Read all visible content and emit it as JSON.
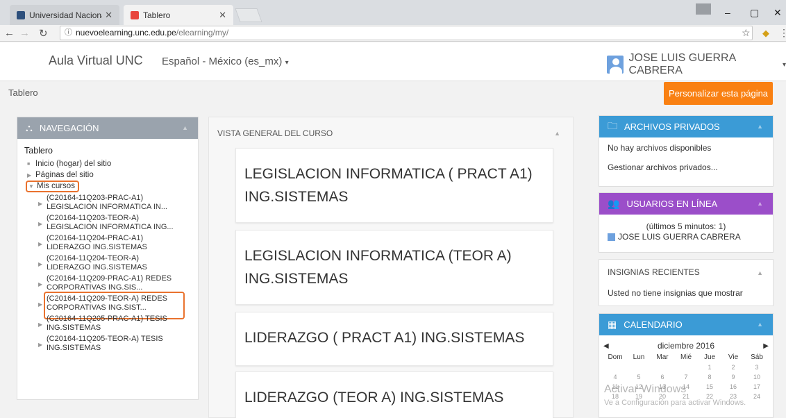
{
  "browser": {
    "tabs": [
      {
        "title": "Universidad Nacional de",
        "favicon_color": "#2d4f7c"
      },
      {
        "title": "Tablero",
        "favicon_color": "#e8453c"
      }
    ],
    "url_host": "nuevoelearning.unc.edu.pe",
    "url_path": "/elearning/my/",
    "minimize": "–",
    "maximize": "▢",
    "close": "✕"
  },
  "navbar": {
    "brand": "Aula Virtual UNC",
    "language": "Español - México (es_mx)",
    "user_name": "JOSE LUIS GUERRA CABRERA"
  },
  "breadcrumb": "Tablero",
  "customize_button": "Personalizar esta página",
  "navigation": {
    "title": "NAVEGACIÓN",
    "root": "Tablero",
    "items": [
      "Inicio (hogar) del sitio",
      "Páginas del sitio",
      "Mis cursos"
    ],
    "courses": [
      {
        "code": "(C20164-11Q203-PRAC-A1)",
        "name": "LEGISLACION INFORMATICA IN..."
      },
      {
        "code": "(C20164-11Q203-TEOR-A)",
        "name": "LEGISLACION INFORMATICA ING..."
      },
      {
        "code": "(C20164-11Q204-PRAC-A1)",
        "name": "LIDERAZGO ING.SISTEMAS"
      },
      {
        "code": "(C20164-11Q204-TEOR-A)",
        "name": "LIDERAZGO ING.SISTEMAS"
      },
      {
        "code": "(C20164-11Q209-PRAC-A1) REDES",
        "name": "CORPORATIVAS ING.SIS..."
      },
      {
        "code": "(C20164-11Q209-TEOR-A) REDES",
        "name": "CORPORATIVAS ING.SIST..."
      },
      {
        "code": "(C20164-11Q205-PRAC-A1) TESIS",
        "name": "ING.SISTEMAS"
      },
      {
        "code": "(C20164-11Q205-TEOR-A) TESIS",
        "name": "ING.SISTEMAS"
      }
    ]
  },
  "overview": {
    "title": "VISTA GENERAL DEL CURSO",
    "courses": [
      "LEGISLACION INFORMATICA ( PRACT A1) ING.SISTEMAS",
      "LEGISLACION INFORMATICA (TEOR A) ING.SISTEMAS",
      "LIDERAZGO ( PRACT A1) ING.SISTEMAS",
      "LIDERAZGO (TEOR A) ING.SISTEMAS"
    ]
  },
  "private_files": {
    "title": "ARCHIVOS PRIVADOS",
    "empty": "No hay archivos disponibles",
    "manage": "Gestionar archivos privados..."
  },
  "online_users": {
    "title": "USUARIOS EN LÍNEA",
    "summary": "(últimos 5 minutos: 1)",
    "user": "JOSE LUIS GUERRA CABRERA"
  },
  "badges": {
    "title": "INSIGNIAS RECIENTES",
    "empty": "Usted no tiene insignias que mostrar"
  },
  "calendar": {
    "title": "CALENDARIO",
    "month": "diciembre 2016",
    "weekdays": [
      "Dom",
      "Lun",
      "Mar",
      "Mié",
      "Jue",
      "Vie",
      "Sáb"
    ],
    "days": [
      "",
      "",
      "",
      "",
      "1",
      "2",
      "3",
      "4",
      "5",
      "6",
      "7",
      "8",
      "9",
      "10",
      "11",
      "12",
      "13",
      "14",
      "15",
      "16",
      "17",
      "18",
      "19",
      "20",
      "21",
      "22",
      "23",
      "24"
    ]
  },
  "watermark": {
    "line1": "Activar Windows",
    "line2": "Ve a Configuración para activar Windows."
  },
  "colors": {
    "accent_orange": "#f98012",
    "block_blue": "#3b9bd6",
    "block_purple": "#9b4ec9",
    "block_grey": "#9aa3ad",
    "highlight_orange": "#e9722e"
  }
}
